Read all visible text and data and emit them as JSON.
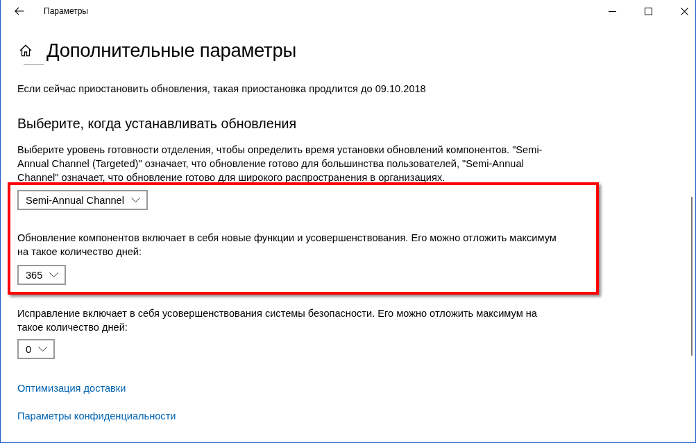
{
  "window": {
    "title": "Параметры"
  },
  "page": {
    "title": "Дополнительные параметры"
  },
  "pause_note": "Если сейчас приостановить обновления, такая приостановка продлится до 09.10.2018",
  "section": {
    "heading": "Выберите, когда устанавливать обновления",
    "description": "Выберите уровень готовности отделения, чтобы определить время установки обновлений компонентов. \"Semi-Annual Channel (Targeted)\" означает, что обновление готово для большинства пользователей, \"Semi-Annual Channel\" означает, что обновление готово для широкого распространения в организациях.",
    "channel_dropdown": {
      "value": "Semi-Annual Channel"
    },
    "feature_updates": {
      "text": "Обновление компонентов включает в себя новые функции и усовершенствования. Его можно отложить максимум на такое количество дней:",
      "dropdown": {
        "value": "365"
      }
    },
    "quality_updates": {
      "text": "Исправление включает в себя усовершенствования системы безопасности. Его можно отложить максимум на такое количество дней:",
      "dropdown": {
        "value": "0"
      }
    }
  },
  "links": [
    {
      "label": "Оптимизация доставки"
    },
    {
      "label": "Параметры конфиденциальности"
    }
  ]
}
